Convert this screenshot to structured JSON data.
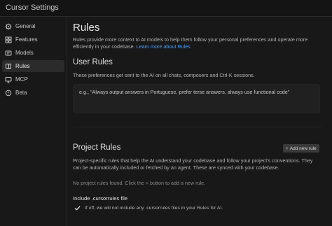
{
  "window": {
    "title": "Cursor Settings"
  },
  "sidebar": {
    "items": [
      {
        "label": "General",
        "icon": "gear-icon",
        "active": false
      },
      {
        "label": "Features",
        "icon": "features-icon",
        "active": false
      },
      {
        "label": "Models",
        "icon": "models-icon",
        "active": false
      },
      {
        "label": "Rules",
        "icon": "rules-book-icon",
        "active": true
      },
      {
        "label": "MCP",
        "icon": "mcp-icon",
        "active": false
      },
      {
        "label": "Beta",
        "icon": "beta-icon",
        "active": false
      }
    ]
  },
  "main": {
    "title": "Rules",
    "description": "Rules provide more context to AI models to help them follow your personal preferences and operate more efficiently in your codebase.",
    "learn_more": "Learn more about Rules",
    "user_rules": {
      "title": "User Rules",
      "subtitle": "These preferences get sent to the AI on all chats, composers and Ctrl-K sessions.",
      "placeholder": "e.g., \"Always output answers in Portuguese, prefer terse answers, always use functional code\"",
      "value": ""
    },
    "project_rules": {
      "title": "Project Rules",
      "add_button": "Add new rule",
      "description": "Project-specific rules that help the AI understand your codebase and follow your project's conventions. They can be automatically included or fetched by an agent. These are synced with your codebase.",
      "empty_text": "No project rules found. Click the + button to add a new rule.",
      "include_title": "Include .cursorrules file",
      "include_checkbox_label": "If off, we will not include any .cursorrules files in your Rules for AI.",
      "include_checked": true
    }
  },
  "colors": {
    "background": "#181818",
    "link": "#4ca0ff",
    "active_item": "#2b2b2b"
  }
}
